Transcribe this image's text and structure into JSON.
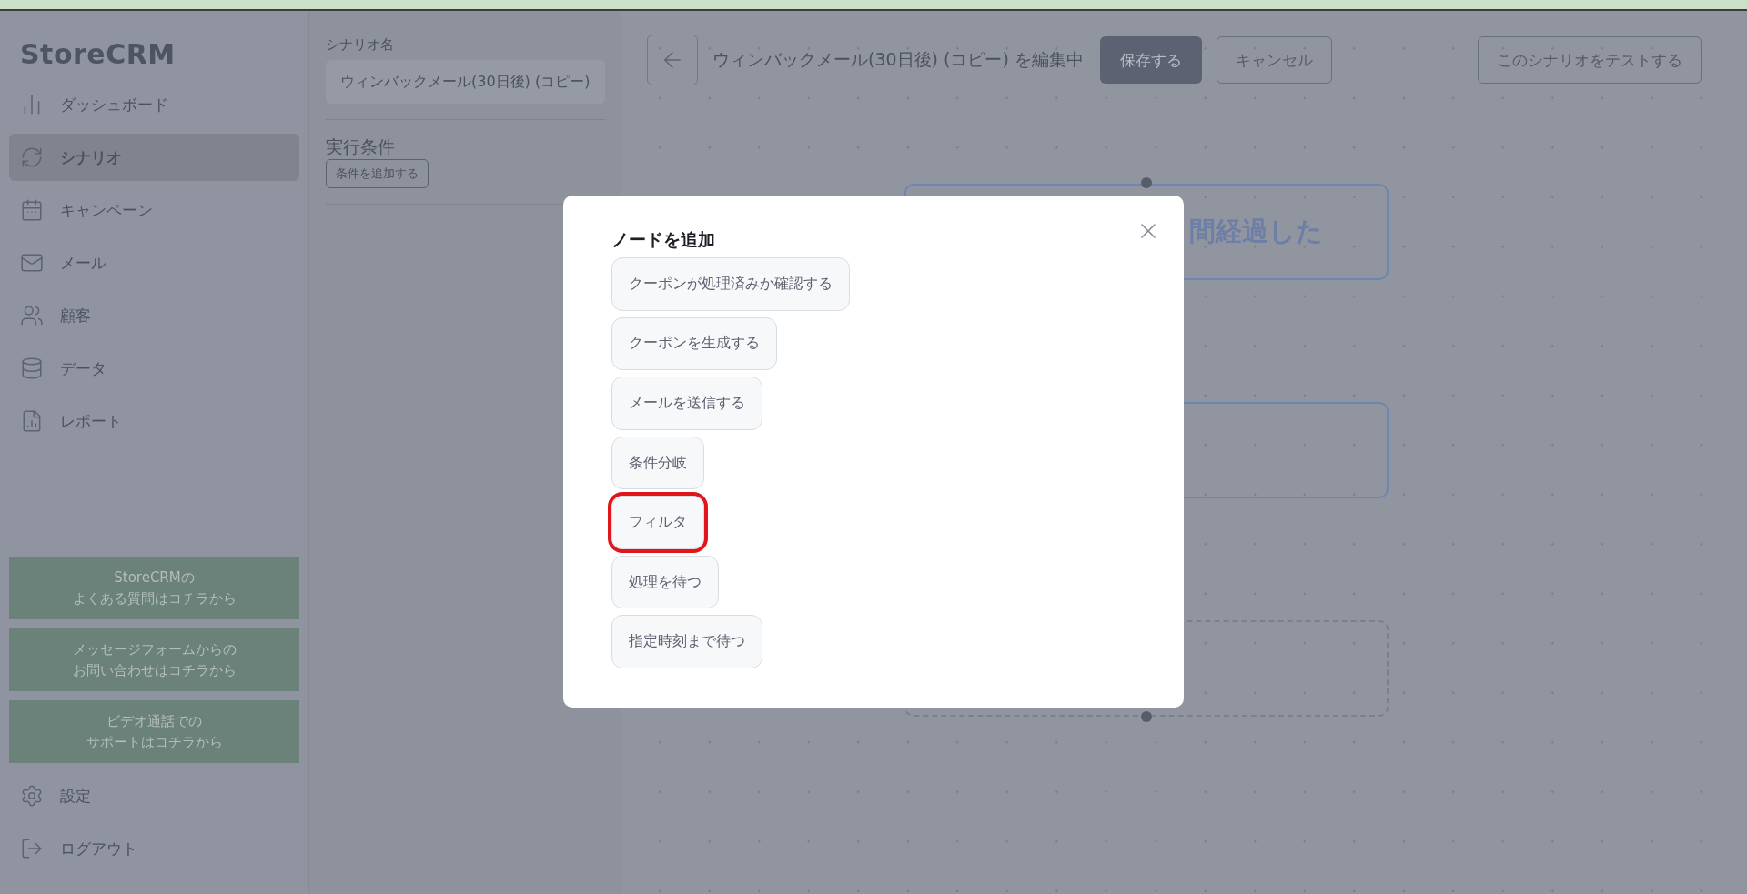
{
  "sidebar": {
    "logo": "StoreCRM",
    "nav": [
      {
        "kind": "dashboard",
        "label": "ダッシュボード",
        "selected": false
      },
      {
        "kind": "scenario",
        "label": "シナリオ",
        "selected": true
      },
      {
        "kind": "campaign",
        "label": "キャンペーン",
        "selected": false
      },
      {
        "kind": "mail",
        "label": "メール",
        "selected": false
      },
      {
        "kind": "customers",
        "label": "顧客",
        "selected": false
      },
      {
        "kind": "data",
        "label": "データ",
        "selected": false
      },
      {
        "kind": "report",
        "label": "レポート",
        "selected": false
      }
    ],
    "help_links": [
      {
        "lines": [
          "StoreCRMの",
          "よくある質問はコチラから"
        ]
      },
      {
        "lines": [
          "メッセージフォームからの",
          "お問い合わせはコチラから"
        ]
      },
      {
        "lines": [
          "ビデオ通話での",
          "サポートはコチラから"
        ]
      }
    ],
    "footer": [
      {
        "kind": "settings",
        "label": "設定"
      },
      {
        "kind": "logout",
        "label": "ログアウト"
      }
    ]
  },
  "scenario_panel": {
    "name_label": "シナリオ名",
    "name_value": "ウィンバックメール(30日後) (コピー)",
    "conditions_label": "実行条件",
    "add_condition_button": "条件を追加する"
  },
  "toolbar": {
    "title": "ウィンバックメール(30日後) (コピー) を編集中",
    "save_button": "保存する",
    "cancel_button": "キャンセル",
    "test_button": "このシナリオをテストする"
  },
  "canvas": {
    "nodes": [
      {
        "kind": "solid",
        "text": "間経過した"
      },
      {
        "kind": "solid"
      },
      {
        "kind": "dashed"
      }
    ]
  },
  "modal": {
    "title": "ノードを追加",
    "options": [
      {
        "label": "クーポンが処理済みか確認する",
        "highlighted": false
      },
      {
        "label": "クーポンを生成する",
        "highlighted": false
      },
      {
        "label": "メールを送信する",
        "highlighted": false
      },
      {
        "label": "条件分岐",
        "highlighted": false
      },
      {
        "label": "フィルタ",
        "highlighted": true
      },
      {
        "label": "処理を待つ",
        "highlighted": false
      },
      {
        "label": "指定時刻まで待つ",
        "highlighted": false
      }
    ]
  }
}
